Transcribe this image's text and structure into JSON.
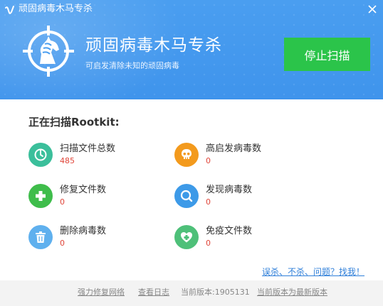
{
  "window": {
    "title": "顽固病毒木马专杀"
  },
  "header": {
    "title": "顽固病毒木马专杀",
    "subtitle": "可启发清除未知的顽固病毒",
    "stop_button": "停止扫描"
  },
  "scan": {
    "title": "正在扫描Rootkit:"
  },
  "stats": [
    {
      "label": "扫描文件总数",
      "value": "485",
      "icon": "timer-icon",
      "color": "#3bbf9b"
    },
    {
      "label": "高启发病毒数",
      "value": "0",
      "icon": "skull-icon",
      "color": "#f39a1d"
    },
    {
      "label": "修复文件数",
      "value": "0",
      "icon": "plus-icon",
      "color": "#3fbd4b"
    },
    {
      "label": "发现病毒数",
      "value": "0",
      "icon": "magnifier-icon",
      "color": "#3d9ae8"
    },
    {
      "label": "删除病毒数",
      "value": "0",
      "icon": "trash-icon",
      "color": "#5fb0ee"
    },
    {
      "label": "免疫文件数",
      "value": "0",
      "icon": "heart-shield-icon",
      "color": "#4ec079"
    }
  ],
  "help_link": "误杀、不杀、问题？找我！",
  "footer": {
    "repair_network": "强力修复网络",
    "view_log": "查看日志",
    "version": "当前版本:1905131",
    "latest": "当前版本为最新版本"
  },
  "colors": {
    "header_blue": "#4a9ef0",
    "button_green": "#2bc44a",
    "value_red": "#e0463a",
    "link_blue": "#2f7fd9"
  }
}
